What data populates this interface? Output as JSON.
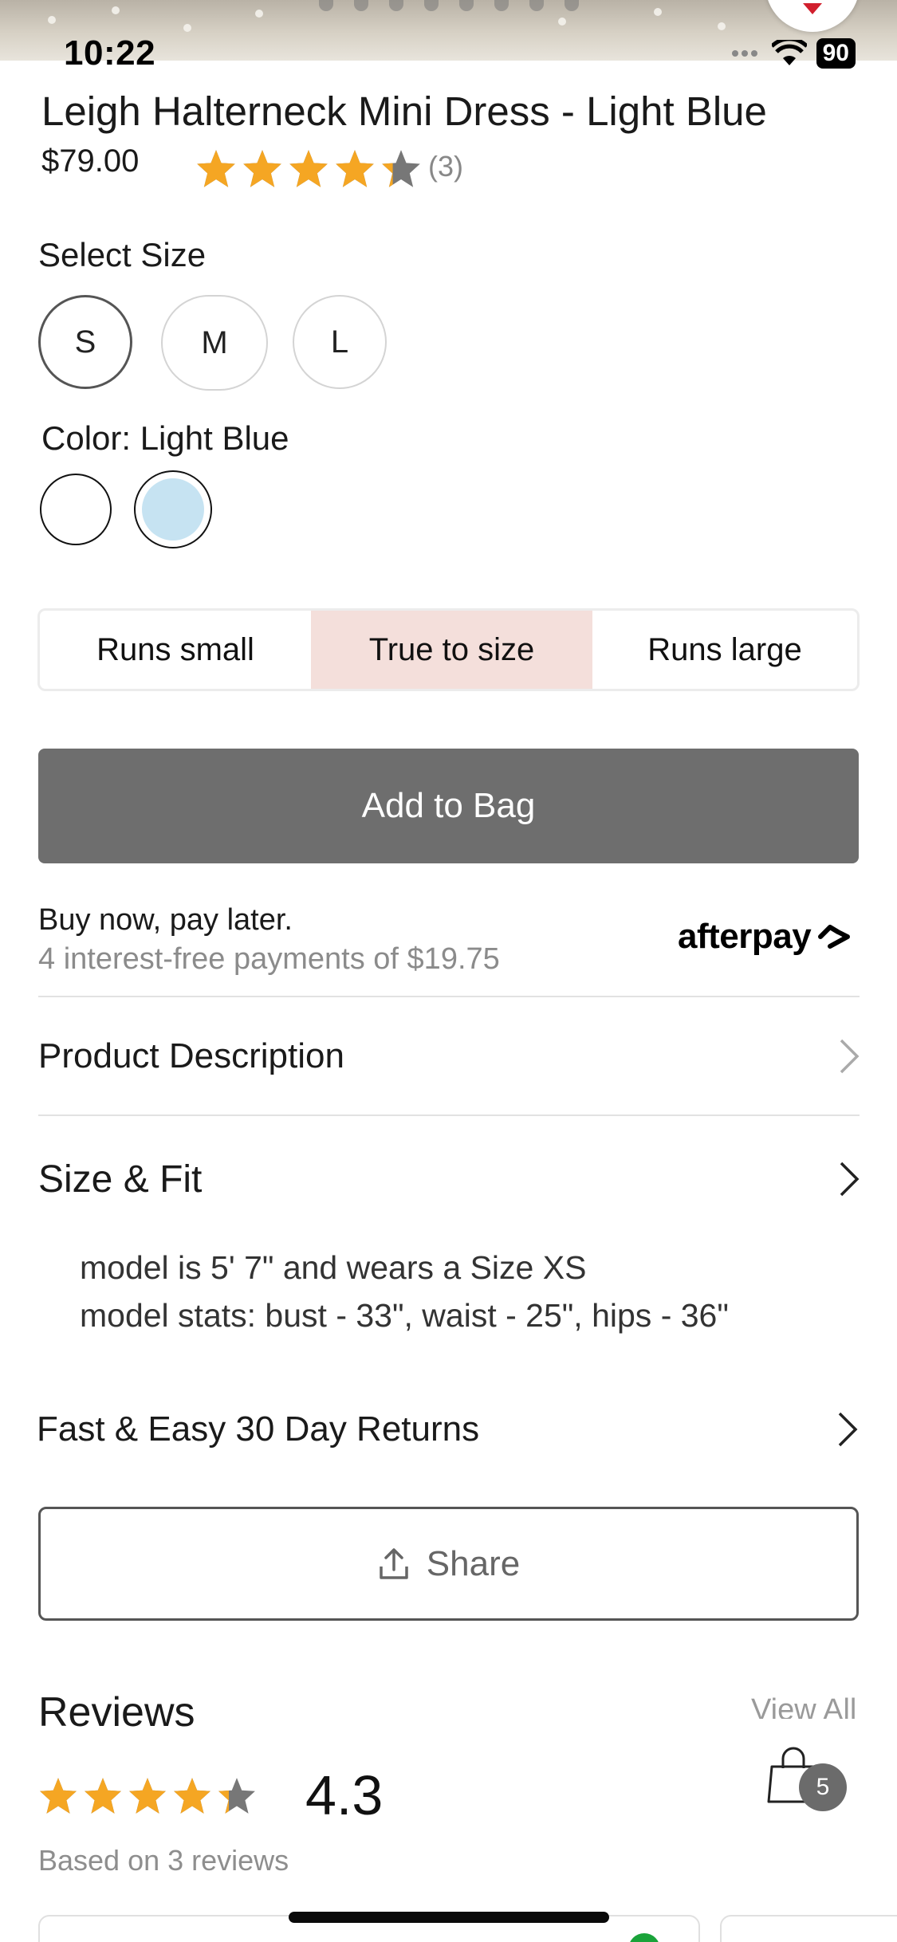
{
  "status_bar": {
    "time": "10:22",
    "battery": "90"
  },
  "product": {
    "title": "Leigh Halterneck Mini Dress - Light Blue",
    "price": "$79.00",
    "rating": 4.3,
    "review_count": "(3)"
  },
  "size": {
    "label": "Select Size",
    "options": [
      "S",
      "M",
      "L"
    ],
    "selected": "S"
  },
  "color": {
    "label": "Color: Light Blue",
    "swatches": [
      "#ffffff",
      "#c6e3f2"
    ],
    "selected_index": 1
  },
  "fit": {
    "options": [
      "Runs small",
      "True to size",
      "Runs large"
    ],
    "selected": "True to size"
  },
  "add_to_bag_label": "Add to Bag",
  "pay_later": {
    "title": "Buy now, pay later.",
    "subtitle": "4 interest-free payments of $19.75",
    "brand": "afterpay"
  },
  "sections": {
    "description": "Product Description",
    "size_fit": "Size & Fit",
    "size_fit_line1": "model is 5' 7\" and wears a Size XS",
    "size_fit_line2": "model stats: bust - 33\", waist - 25\", hips - 36\"",
    "returns": "Fast & Easy 30 Day Returns"
  },
  "share_label": "Share",
  "reviews": {
    "heading": "Reviews",
    "view_all": "View All",
    "average": "4.3",
    "based_on": "Based on 3 reviews"
  },
  "bag": {
    "count": "5"
  },
  "colors": {
    "star": "#f5a623",
    "fit_selected": "#f4dfdb",
    "button_gray": "#6e6e6e",
    "swatch_blue": "#c6e3f2"
  }
}
